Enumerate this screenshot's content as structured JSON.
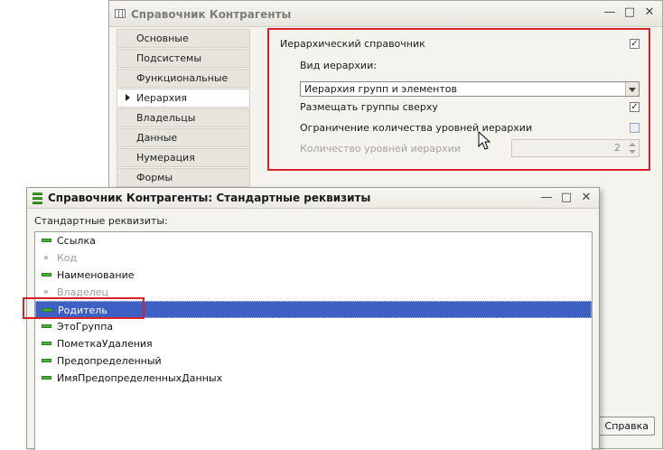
{
  "back_window": {
    "title": "Справочник Контрагенты",
    "title_icon": "table-icon",
    "nav_items": [
      {
        "label": "Основные",
        "active": false
      },
      {
        "label": "Подсистемы",
        "active": false
      },
      {
        "label": "Функциональные опции",
        "active": false
      },
      {
        "label": "Иерархия",
        "active": true
      },
      {
        "label": "Владельцы",
        "active": false
      },
      {
        "label": "Данные",
        "active": false
      },
      {
        "label": "Нумерация",
        "active": false
      },
      {
        "label": "Формы",
        "active": false
      }
    ],
    "hierarchy": {
      "hierarchical_label": "Иерархический справочник",
      "hierarchical_checked": true,
      "hierarchy_type_label": "Вид иерархии:",
      "hierarchy_type_value": "Иерархия групп и элементов",
      "groups_on_top_label": "Размещать группы сверху",
      "groups_on_top_checked": true,
      "limit_levels_label": "Ограничение количества уровней иерархии",
      "limit_levels_checked": false,
      "levels_count_label": "Количество уровней иерархии",
      "levels_count_value": "2"
    },
    "help_button_label": "Справка"
  },
  "front_window": {
    "title": "Справочник Контрагенты: Стандартные реквизиты",
    "list_label": "Стандартные реквизиты:",
    "items": [
      {
        "label": "Ссылка",
        "enabled": true
      },
      {
        "label": "Код",
        "enabled": false
      },
      {
        "label": "Наименование",
        "enabled": true
      },
      {
        "label": "Владелец",
        "enabled": false
      },
      {
        "label": "Родитель",
        "enabled": true,
        "selected": true
      },
      {
        "label": "ЭтоГруппа",
        "enabled": true
      },
      {
        "label": "ПометкаУдаления",
        "enabled": true
      },
      {
        "label": "Предопределенный",
        "enabled": true
      },
      {
        "label": "ИмяПредопределенныхДанных",
        "enabled": true
      }
    ]
  },
  "colors": {
    "highlight_border": "#d6232a",
    "selection": "#3e5fc3",
    "enabled_marker": "#48b336"
  }
}
